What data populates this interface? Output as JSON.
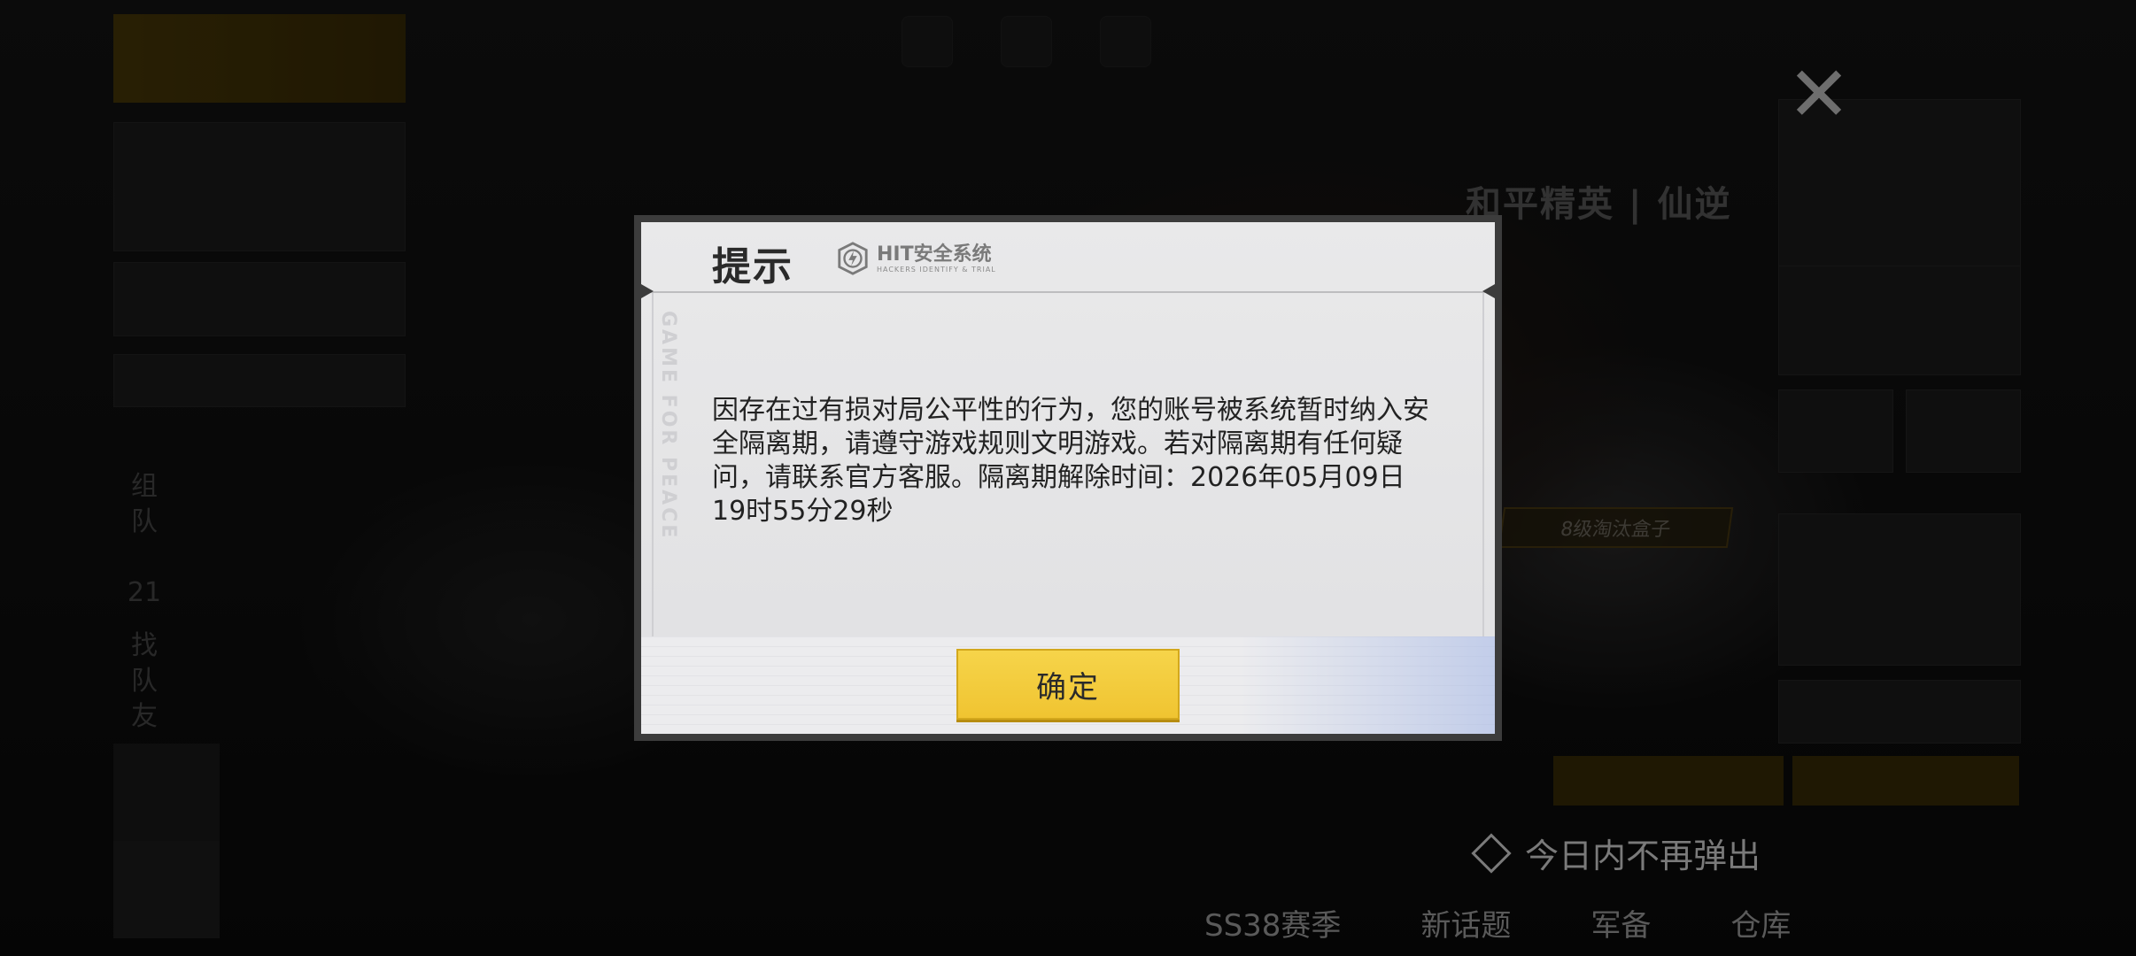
{
  "background": {
    "no_popup_label": "今日内不再弹出",
    "close_symbol": "✕",
    "logo_text": "和平精英 | 仙逆",
    "banner_label": "8级淘汰盒子",
    "bottom_nav": [
      "SS38赛季",
      "新话题",
      "军备",
      "仓库"
    ]
  },
  "dialog": {
    "title": "提示",
    "security_logo": {
      "icon": "shield-bolt-icon",
      "name": "HIT安全系统",
      "subtitle": "HACKERS IDENTIFY & TRIAL"
    },
    "watermark": "GAME FOR PEACE",
    "message": "因存在过有损对局公平性的行为，您的账号被系统暂时纳入安全隔离期，请遵守游戏规则文明游戏。若对隔离期有任何疑问，请联系官方客服。隔离期解除时间：2026年05月09日19时55分29秒",
    "confirm_label": "确定",
    "colors": {
      "button": "#f3c93c",
      "panel": "#e4e4e6",
      "frame": "#3c3c3c"
    }
  }
}
